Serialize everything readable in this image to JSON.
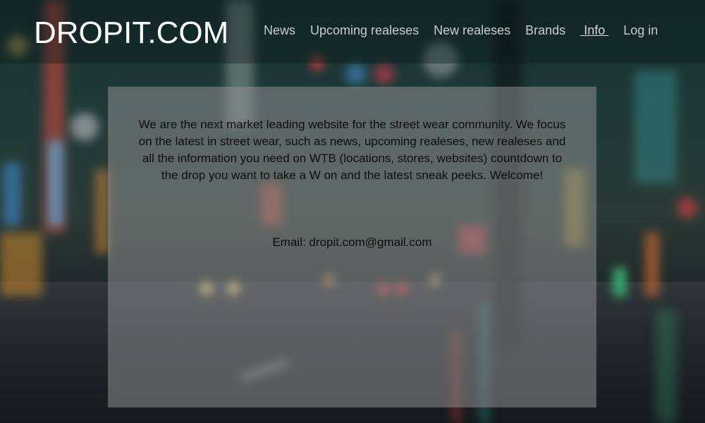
{
  "site": {
    "logo": "DROPIT.COM"
  },
  "nav": {
    "items": [
      {
        "label": "News"
      },
      {
        "label": "Upcoming realeses"
      },
      {
        "label": "New realeses"
      },
      {
        "label": "Brands"
      },
      {
        "label": " Info "
      },
      {
        "label": "Log in"
      }
    ],
    "active": " Info "
  },
  "main": {
    "description": "We are the next market leading website for the street wear community. We focus on the latest in street wear, such as news, upcoming realeses, new realeses and all the information you need on WTB (locations, stores, websites) countdown to the drop you want to take a W on and the latest sneak peeks. Welcome!",
    "email": "Email: dropit.com@gmail.com"
  },
  "colors": {
    "logo": "#ffffff",
    "nav_text": "#c8cdcf",
    "panel_bg": "rgba(150,150,150,0.5)",
    "body_text": "#0c0c0c"
  }
}
